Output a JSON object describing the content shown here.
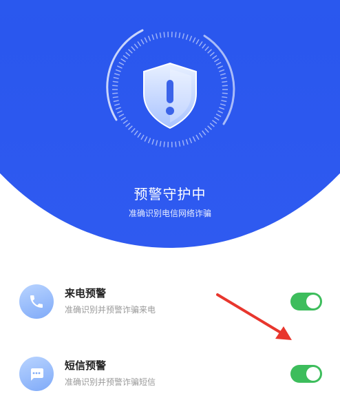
{
  "hero": {
    "title": "预警守护中",
    "subtitle": "准确识别电信网络诈骗",
    "shield_icon": "shield-exclamation-icon",
    "colors": {
      "background": "#2a57ee",
      "shield": "#dfe9ff",
      "accent": "#ffffff"
    }
  },
  "features": [
    {
      "title": "来电预警",
      "subtitle": "准确识别并预警诈骗来电",
      "icon": "phone-icon",
      "enabled": true
    },
    {
      "title": "短信预警",
      "subtitle": "准确识别并预警诈骗短信",
      "icon": "message-icon",
      "enabled": true
    }
  ],
  "colors": {
    "toggle_on": "#3dbd5c",
    "annotation_arrow": "#e8362d"
  }
}
